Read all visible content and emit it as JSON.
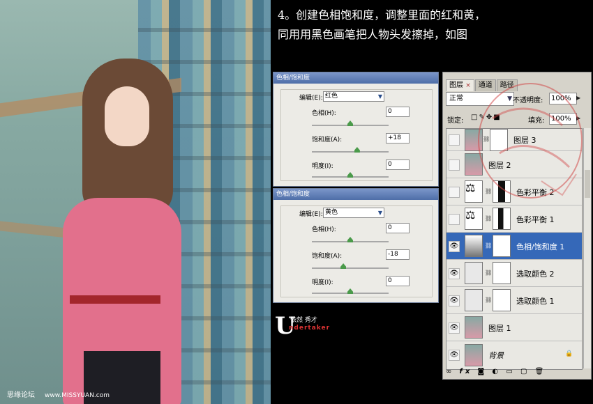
{
  "instruction": {
    "line1": "4。创建色相饱和度，调整里面的红和黄，",
    "line2": "同用用黑色画笔把人物头发擦掉，如图"
  },
  "watermark_left": {
    "name": "思缘论坛",
    "site": "www.MISSYUAN.com"
  },
  "dialog_red": {
    "title": "色相/饱和度",
    "edit_label": "编辑(E):",
    "edit_value": "红色",
    "hue_label": "色相(H):",
    "hue_value": "0",
    "hue_level": 0,
    "sat_label": "饱和度(A):",
    "sat_value": "+18",
    "sat_level": 18,
    "light_label": "明度(I):",
    "light_value": "0",
    "light_level": 0
  },
  "dialog_yellow": {
    "title": "色相/饱和度",
    "edit_label": "编辑(E):",
    "edit_value": "黄色",
    "hue_label": "色相(H):",
    "hue_value": "0",
    "hue_level": 0,
    "sat_label": "饱和度(A):",
    "sat_value": "-18",
    "sat_level": -18,
    "light_label": "明度(I):",
    "light_value": "0",
    "light_level": 0
  },
  "logo": {
    "letter": "U",
    "chinese": "依然 秀才",
    "english": "ndertaker"
  },
  "layers_panel": {
    "tabs": [
      "图层",
      "通道",
      "路径"
    ],
    "tab_close": "×",
    "blend_mode": "正常",
    "opacity_label": "不透明度:",
    "opacity_value": "100%",
    "lock_label": "锁定:",
    "fill_label": "填充:",
    "fill_value": "100%",
    "layers": [
      {
        "name": "图层 3",
        "visible": false,
        "selected": false,
        "has_mask": true
      },
      {
        "name": "图层 2",
        "visible": false,
        "selected": false,
        "has_mask": false
      },
      {
        "name": "色彩平衡 2",
        "visible": false,
        "selected": false,
        "has_mask": true
      },
      {
        "name": "色彩平衡 1",
        "visible": false,
        "selected": false,
        "has_mask": true
      },
      {
        "name": "色相/饱和度 1",
        "visible": true,
        "selected": true,
        "has_mask": true
      },
      {
        "name": "选取颜色 2",
        "visible": true,
        "selected": false,
        "has_mask": true
      },
      {
        "name": "选取颜色 1",
        "visible": true,
        "selected": false,
        "has_mask": true
      },
      {
        "name": "图层 1",
        "visible": true,
        "selected": false,
        "has_mask": false
      },
      {
        "name": "背景",
        "visible": true,
        "selected": false,
        "has_mask": false,
        "locked": true
      }
    ],
    "bottom_icons": [
      "link-icon",
      "fx-icon",
      "mask-icon",
      "adjustment-icon",
      "folder-icon",
      "new-layer-icon",
      "trash-icon"
    ]
  },
  "colors": {
    "selection": "#3568b8",
    "dialog_title": "#5a78b0",
    "shirt": "#e2708c"
  }
}
